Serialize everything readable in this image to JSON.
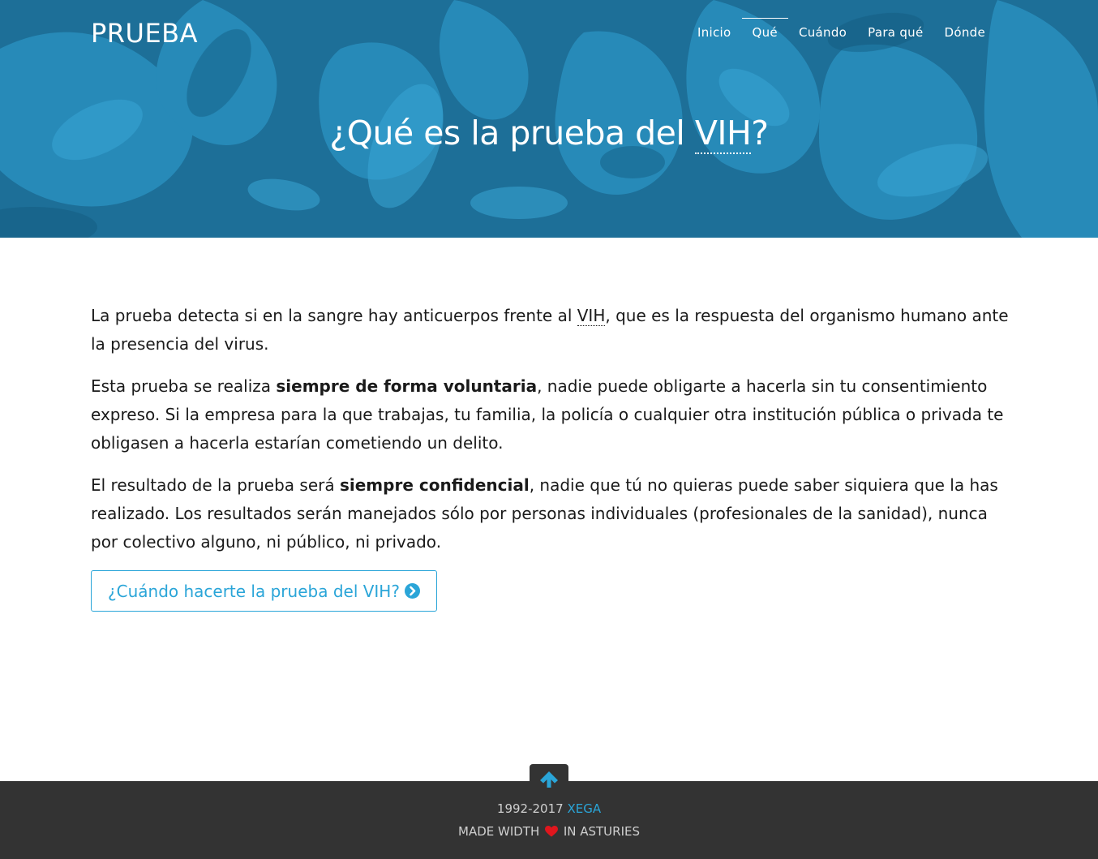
{
  "colors": {
    "hero_bg": "#1f7aa6",
    "accent": "#2aa5d8",
    "footer_bg": "#333333",
    "heart": "#e0161d"
  },
  "header": {
    "brand": "PRUEBA",
    "nav": [
      {
        "label": "Inicio",
        "active": false
      },
      {
        "label": "Qué",
        "active": true
      },
      {
        "label": "Cuándo",
        "active": false
      },
      {
        "label": "Para qué",
        "active": false
      },
      {
        "label": "Dónde",
        "active": false
      }
    ]
  },
  "hero": {
    "title_before": "¿Qué es la prueba del ",
    "title_abbr": "VIH",
    "title_after": "?"
  },
  "content": {
    "p1_before": "La prueba detecta si en la sangre hay anticuerpos frente al ",
    "p1_abbr": "VIH",
    "p1_after": ", que es la respuesta del organismo humano ante la presencia del virus.",
    "p2_before": "Esta prueba se realiza ",
    "p2_strong": "siempre de forma voluntaria",
    "p2_after": ", nadie puede obligarte a hacerla sin tu consentimiento expreso. Si la empresa para la que trabajas, tu familia, la policía o cualquier otra institución pública o privada te obligasen a hacerla estarían cometiendo un delito.",
    "p3_before": "El resultado de la prueba será ",
    "p3_strong": "siempre confidencial",
    "p3_after": ", nadie que tú no quieras puede saber siquiera que la has realizado. Los resultados serán manejados sólo por personas individuales (profesionales de la sanidad), nunca por colectivo alguno, ni público, ni privado.",
    "cta_label": "¿Cuándo hacerte la prueba del VIH?",
    "cta_icon": "chevron-circle-right-icon"
  },
  "footer": {
    "years": "1992-2017",
    "author": "XEGA",
    "made_before": "Made width",
    "made_after": "in Asturies",
    "to_top_icon": "arrow-up-icon",
    "heart_icon": "heart-icon"
  }
}
